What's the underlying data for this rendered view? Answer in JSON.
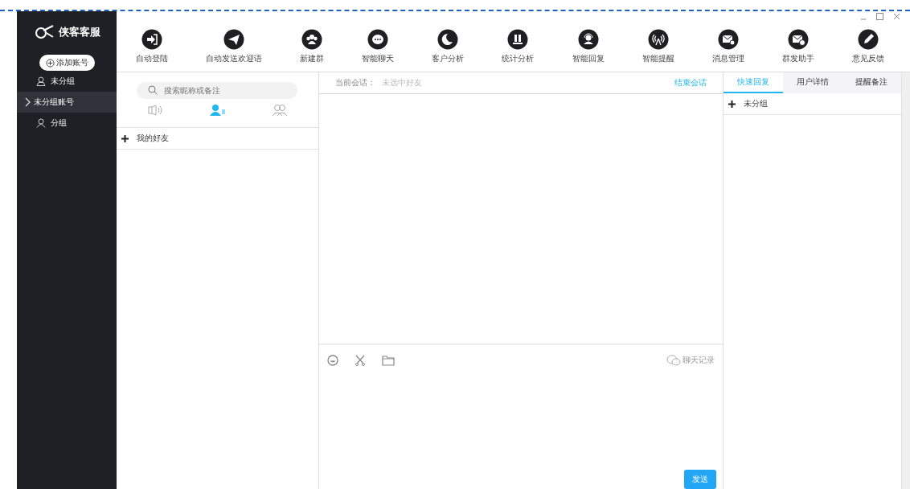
{
  "app": {
    "logo_text": "侠客客服",
    "add_account": "添加账号"
  },
  "sidebar": {
    "items": [
      {
        "label": "未分组",
        "kind": "lock",
        "selected": false
      },
      {
        "label": "未分组账号",
        "kind": "chevron",
        "selected": true
      },
      {
        "label": "分组",
        "kind": "user",
        "selected": false
      }
    ]
  },
  "toolbar": [
    {
      "label": "自动登陆"
    },
    {
      "label": "自动发送欢迎语"
    },
    {
      "label": "新建群"
    },
    {
      "label": "智能聊天"
    },
    {
      "label": "客户分析"
    },
    {
      "label": "统计分析"
    },
    {
      "label": "智能回复"
    },
    {
      "label": "智能提醒"
    },
    {
      "label": "消息管理"
    },
    {
      "label": "群发助手"
    },
    {
      "label": "意见反馈"
    }
  ],
  "contacts": {
    "search": {
      "placeholder": "搜索昵称或备注"
    },
    "tabs": [
      {
        "selected": false
      },
      {
        "selected": true
      },
      {
        "selected": false
      }
    ],
    "groups": [
      {
        "label": "我的好友"
      }
    ]
  },
  "chat": {
    "current_label": "当前会话：",
    "current_value": "未选中好友",
    "end_link": "结束会话",
    "history": "聊天记录",
    "send": "发送"
  },
  "right": {
    "tabs": [
      {
        "label": "快速回复",
        "selected": true
      },
      {
        "label": "用户详情",
        "selected": false
      },
      {
        "label": "提醒备注",
        "selected": false
      }
    ],
    "groups": [
      {
        "label": "未分组"
      }
    ]
  }
}
